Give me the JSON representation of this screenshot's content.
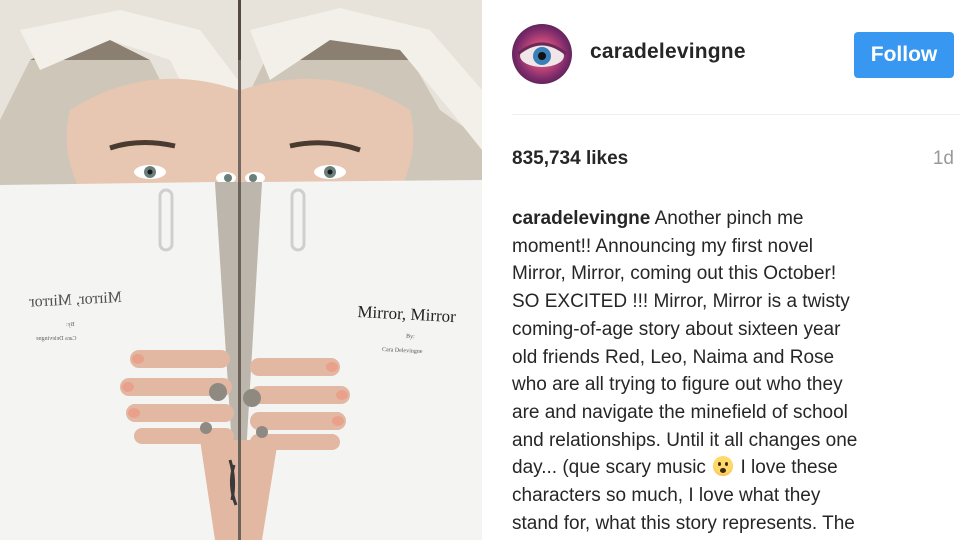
{
  "post": {
    "username": "caradelevingne",
    "follow_label": "Follow",
    "likes": "835,734 likes",
    "time": "1d"
  },
  "caption": {
    "username": "caradelevingne",
    "line1_tail": "Another pinch me",
    "line2": "moment!! Announcing my first novel",
    "line3": "Mirror, Mirror, coming out this October!",
    "line4": "SO EXCITED !!! Mirror, Mirror is a twisty",
    "line5": "coming-of-age story about sixteen year",
    "line6": "old friends Red, Leo, Naima and Rose",
    "line7": "who are all trying to figure out who they",
    "line8": "are and navigate the minefield of school",
    "line9": "and relationships. Until it all changes one",
    "line10_pre": "day... (que scary music",
    "line10_post": "I love these",
    "line11": "characters so much, I love what they",
    "line12": "stand for, what this story represents. The",
    "emoji": "astonished-face"
  },
  "photo": {
    "manuscript_title": "Mirror, Mirror",
    "manuscript_by": "By:",
    "manuscript_author": "Cara Delevingne"
  },
  "colors": {
    "follow_button": "#3897f0",
    "text": "#262626",
    "muted": "#999999"
  }
}
